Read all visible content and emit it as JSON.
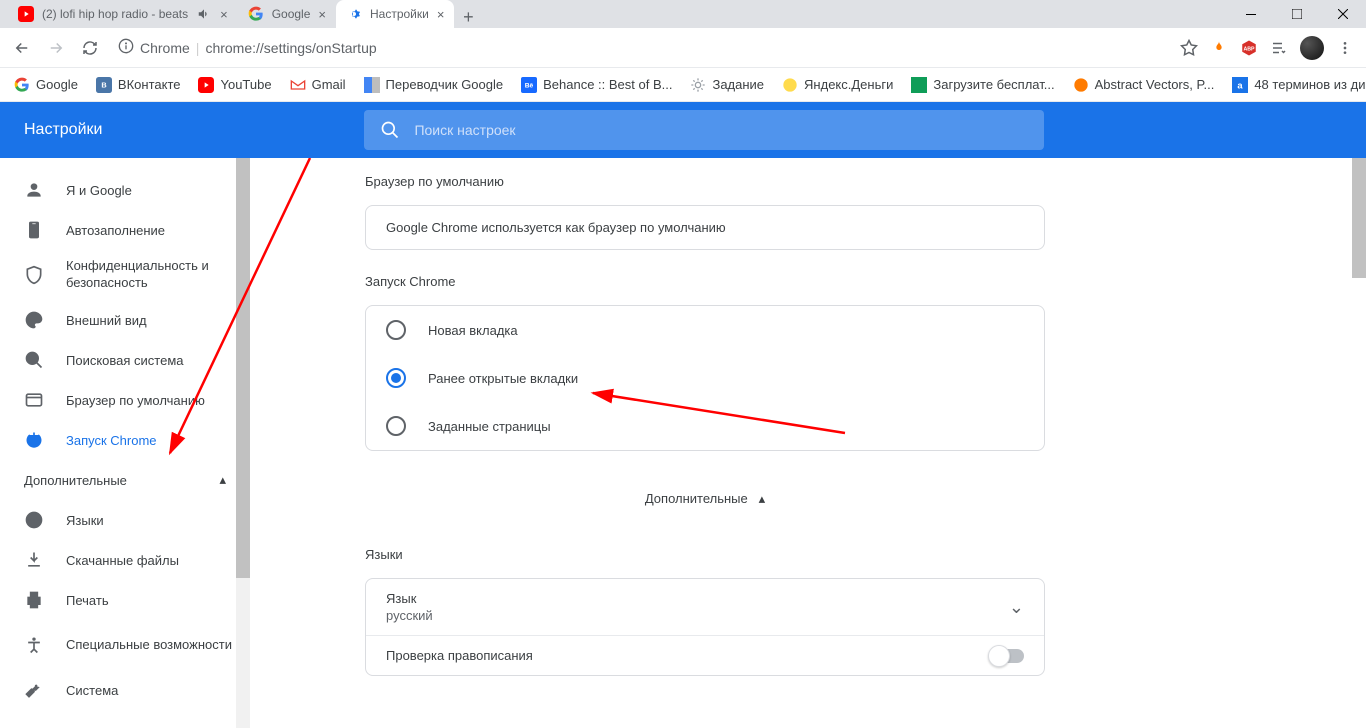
{
  "tabs": [
    {
      "title": "(2) lofi hip hop radio - beats"
    },
    {
      "title": "Google"
    },
    {
      "title": "Настройки"
    }
  ],
  "address": {
    "source_label": "Chrome",
    "url": "chrome://settings/onStartup"
  },
  "bookmarks": [
    {
      "label": "Google"
    },
    {
      "label": "ВКонтакте"
    },
    {
      "label": "YouTube"
    },
    {
      "label": "Gmail"
    },
    {
      "label": "Переводчик Google"
    },
    {
      "label": "Behance :: Best of B..."
    },
    {
      "label": "Задание"
    },
    {
      "label": "Яндекс.Деньги"
    },
    {
      "label": "Загрузите бесплат..."
    },
    {
      "label": "Abstract Vectors, P..."
    },
    {
      "label": "48 терминов из ди..."
    }
  ],
  "app": {
    "title": "Настройки",
    "search_placeholder": "Поиск настроек"
  },
  "sidebar": {
    "items": [
      {
        "label": "Я и Google"
      },
      {
        "label": "Автозаполнение"
      },
      {
        "label": "Конфиденциальность и безопасность"
      },
      {
        "label": "Внешний вид"
      },
      {
        "label": "Поисковая система"
      },
      {
        "label": "Браузер по умолчанию"
      },
      {
        "label": "Запуск Chrome"
      }
    ],
    "advanced": "Дополнительные",
    "adv_items": [
      {
        "label": "Языки"
      },
      {
        "label": "Скачанные файлы"
      },
      {
        "label": "Печать"
      },
      {
        "label": "Специальные возможности"
      },
      {
        "label": "Система"
      }
    ]
  },
  "sections": {
    "default_browser": {
      "title": "Браузер по умолчанию",
      "text": "Google Chrome используется как браузер по умолчанию"
    },
    "startup": {
      "title": "Запуск Chrome",
      "options": [
        {
          "label": "Новая вкладка"
        },
        {
          "label": "Ранее открытые вкладки"
        },
        {
          "label": "Заданные страницы"
        }
      ]
    },
    "advanced_label": "Дополнительные",
    "languages": {
      "title": "Языки",
      "lang_label": "Язык",
      "lang_value": "русский",
      "spellcheck": "Проверка правописания"
    }
  }
}
